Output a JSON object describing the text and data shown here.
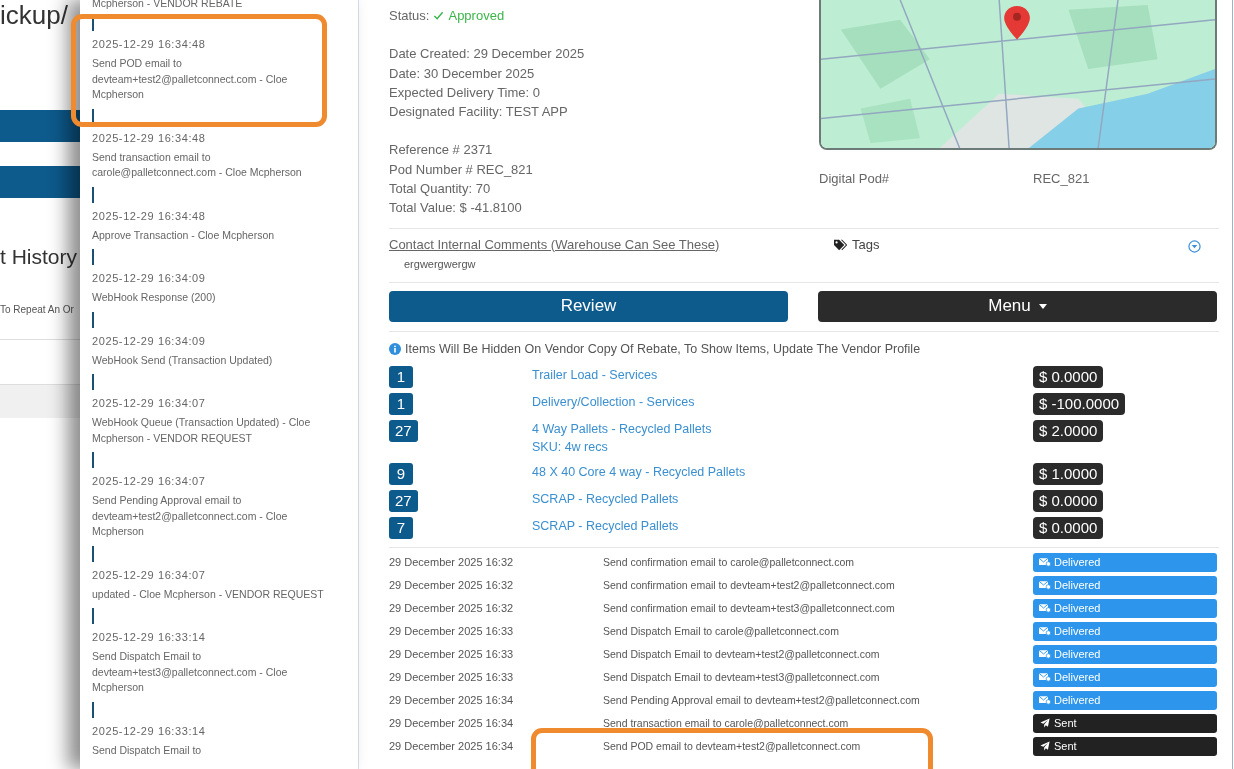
{
  "background_page": {
    "title": "ickup/",
    "heading": "t History",
    "hint": "To Repeat An Or"
  },
  "history_drawer": {
    "top_text": "Mcpherson - VENDOR REBATE",
    "entries": [
      {
        "time": "2025-12-29 16:34:48",
        "text": "Send POD email to devteam+test2@palletconnect.com - Cloe Mcpherson"
      },
      {
        "time": "2025-12-29 16:34:48",
        "text": "Send transaction email to carole@palletconnect.com - Cloe Mcpherson"
      },
      {
        "time": "2025-12-29 16:34:48",
        "text": "Approve Transaction - Cloe Mcpherson"
      },
      {
        "time": "2025-12-29 16:34:09",
        "text": "WebHook Response (200)"
      },
      {
        "time": "2025-12-29 16:34:09",
        "text": "WebHook Send (Transaction Updated)"
      },
      {
        "time": "2025-12-29 16:34:07",
        "text": "WebHook Queue (Transaction Updated) - Cloe Mcpherson - VENDOR REQUEST"
      },
      {
        "time": "2025-12-29 16:34:07",
        "text": "Send Pending Approval email to devteam+test2@palletconnect.com - Cloe Mcpherson"
      },
      {
        "time": "2025-12-29 16:34:07",
        "text": "updated - Cloe Mcpherson - VENDOR REQUEST"
      },
      {
        "time": "2025-12-29 16:33:14",
        "text": "Send Dispatch Email to devteam+test3@palletconnect.com - Cloe Mcpherson"
      },
      {
        "time": "2025-12-29 16:33:14",
        "text": "Send Dispatch Email to"
      }
    ]
  },
  "transaction": {
    "status": {
      "label": "Status:",
      "value": "Approved",
      "kind": "approved"
    },
    "dates": [
      "Date Created: 29 December 2025",
      "Date: 30 December 2025",
      "Expected Delivery Time: 0",
      "Designated Facility: TEST APP"
    ],
    "references": [
      "Reference # 2371",
      "Pod Number # REC_821",
      "Total Quantity: 70",
      "Total Value: $ -41.8100"
    ],
    "digital_pod": {
      "label": "Digital Pod#",
      "value": "REC_821"
    },
    "comments": {
      "link": "Contact Internal Comments (Warehouse Can See These)",
      "text": "ergwergwergw"
    },
    "tags": {
      "label": "Tags"
    },
    "buttons": [
      {
        "label": "Review",
        "kind": "primary"
      },
      {
        "label": "Menu",
        "kind": "dropdown"
      }
    ],
    "notice": "Items Will Be Hidden On Vendor Copy Of Rebate, To Show Items, Update The Vendor Profile",
    "items": [
      {
        "qty": "1",
        "name": "Trailer Load - Services",
        "price": "$ 0.0000"
      },
      {
        "qty": "1",
        "name": "Delivery/Collection - Services",
        "price": "$ -100.0000"
      },
      {
        "qty": "27",
        "name": "4 Way Pallets - Recycled Pallets",
        "sku": "SKU: 4w recs",
        "price": "$ 2.0000"
      },
      {
        "qty": "9",
        "name": "48 X 40 Core 4 way - Recycled Pallets",
        "price": "$ 1.0000"
      },
      {
        "qty": "27",
        "name": "SCRAP - Recycled Pallets",
        "price": "$ 0.0000"
      },
      {
        "qty": "7",
        "name": "SCRAP - Recycled Pallets",
        "price": "$ 0.0000"
      }
    ],
    "email_log": [
      {
        "date": "29 December 2025 16:32",
        "message": "Send confirmation email to carole@palletconnect.com",
        "status": "Delivered",
        "kind": "delivered"
      },
      {
        "date": "29 December 2025 16:32",
        "message": "Send confirmation email to devteam+test2@palletconnect.com",
        "status": "Delivered",
        "kind": "delivered"
      },
      {
        "date": "29 December 2025 16:32",
        "message": "Send confirmation email to devteam+test3@palletconnect.com",
        "status": "Delivered",
        "kind": "delivered"
      },
      {
        "date": "29 December 2025 16:33",
        "message": "Send Dispatch Email to carole@palletconnect.com",
        "status": "Delivered",
        "kind": "delivered"
      },
      {
        "date": "29 December 2025 16:33",
        "message": "Send Dispatch Email to devteam+test2@palletconnect.com",
        "status": "Delivered",
        "kind": "delivered"
      },
      {
        "date": "29 December 2025 16:33",
        "message": "Send Dispatch Email to devteam+test3@palletconnect.com",
        "status": "Delivered",
        "kind": "delivered"
      },
      {
        "date": "29 December 2025 16:34",
        "message": "Send Pending Approval email to devteam+test2@palletconnect.com",
        "status": "Delivered",
        "kind": "delivered"
      },
      {
        "date": "29 December 2025 16:34",
        "message": "Send transaction email to carole@palletconnect.com",
        "status": "Sent",
        "kind": "sent"
      },
      {
        "date": "29 December 2025 16:34",
        "message": "Send POD email to devteam+test2@palletconnect.com",
        "status": "Sent",
        "kind": "sent"
      }
    ]
  }
}
